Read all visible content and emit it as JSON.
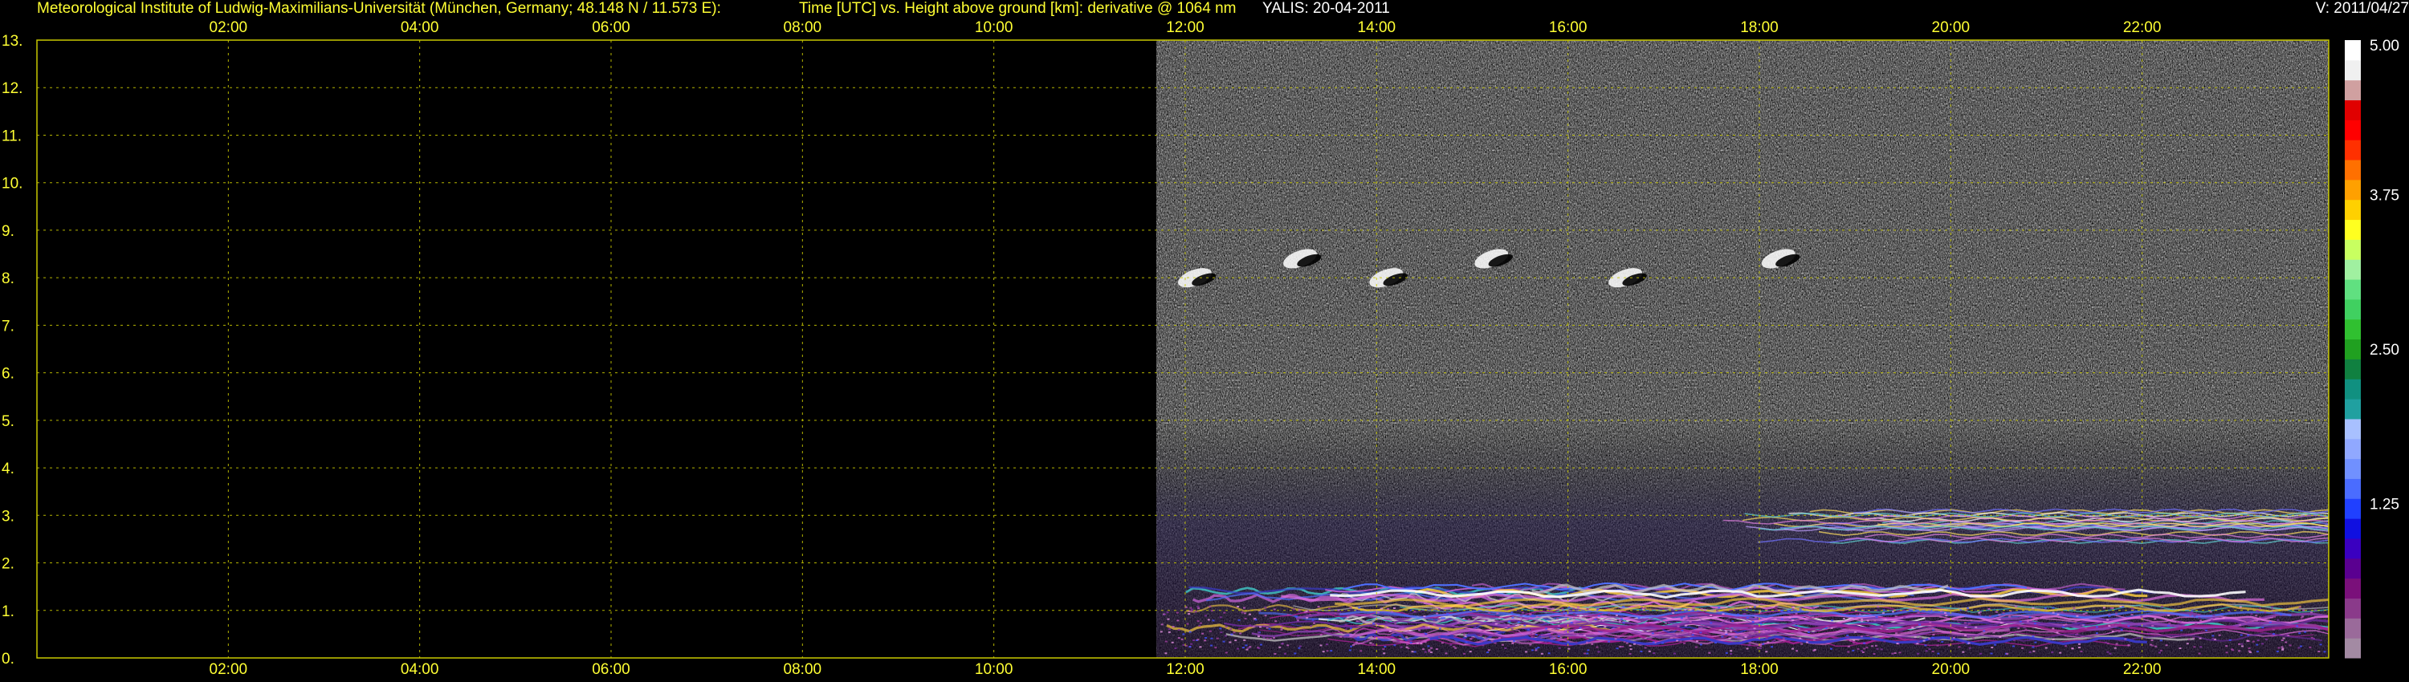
{
  "header": {
    "institute": "Meteorological Institute of Ludwig-Maximilians-Universität (München, Germany; 48.148 N / 11.573 E):",
    "description": "Time [UTC] vs. Height above ground [km]: derivative @ 1064 nm",
    "instrument": "YALIS: 20-04-2011",
    "version": "V: 2011/04/27"
  },
  "colors": {
    "text": "#ffff33",
    "grid": "#c8c800",
    "background": "#000000"
  },
  "chart_data": {
    "type": "heatmap",
    "xlabel": "Time [UTC]",
    "ylabel": "Height above ground [km]",
    "x_ticks": [
      "02:00",
      "04:00",
      "06:00",
      "08:00",
      "10:00",
      "12:00",
      "14:00",
      "16:00",
      "18:00",
      "20:00",
      "22:00"
    ],
    "x_tick_hours": [
      2,
      4,
      6,
      8,
      10,
      12,
      14,
      16,
      18,
      20,
      22
    ],
    "xlim_hours": [
      0,
      23.95
    ],
    "y_ticks": [
      "0.",
      "1.",
      "2.",
      "3.",
      "4.",
      "5.",
      "6.",
      "7.",
      "8.",
      "9.",
      "10.",
      "11.",
      "12.",
      "13."
    ],
    "ylim_km": [
      0,
      13
    ],
    "grid": true,
    "data_start_hour": 11.7,
    "colorbar": {
      "ticks": [
        "1.25",
        "2.50",
        "3.75",
        "5.00"
      ],
      "tick_values": [
        1.25,
        2.5,
        3.75,
        5.0
      ],
      "range": [
        0,
        5.0
      ],
      "colors": [
        "#a38aa3",
        "#9a6a9a",
        "#8a3a8a",
        "#7a107a",
        "#5a0090",
        "#3a00c0",
        "#1010e0",
        "#2040ff",
        "#4a6cff",
        "#7090ff",
        "#90a8ff",
        "#a8c0ff",
        "#20a0a0",
        "#109080",
        "#108040",
        "#20a020",
        "#30c030",
        "#40d060",
        "#60e080",
        "#a0f0a0",
        "#c8ff60",
        "#ffff20",
        "#ffd000",
        "#ffa000",
        "#ff7000",
        "#ff3000",
        "#ff0000",
        "#e00000",
        "#d0a0a0",
        "#f0f0f0",
        "#ffffff"
      ]
    },
    "features": [
      {
        "name": "boundary layer",
        "start_hour": 11.7,
        "end_hour": 23.95,
        "height_km": [
          0.3,
          1.5
        ]
      },
      {
        "name": "aerosol layer",
        "start_hour": 17.5,
        "end_hour": 23.95,
        "height_km": [
          2.4,
          3.1
        ]
      },
      {
        "name": "cloud patches",
        "start_hour": 11.7,
        "end_hour": 18.4,
        "height_km": [
          7.8,
          9.0
        ]
      }
    ]
  }
}
